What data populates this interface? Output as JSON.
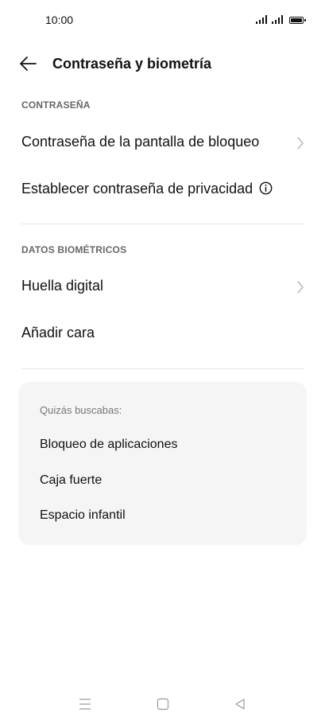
{
  "status_bar": {
    "time": "10:00"
  },
  "header": {
    "title": "Contraseña y biometría",
    "back_icon": "arrow-left-icon"
  },
  "sections": {
    "password": {
      "label": "CONTRASEÑA",
      "items": [
        {
          "label": "Contraseña de la pantalla de bloqueo",
          "trailing": "chevron-right-icon"
        },
        {
          "label": "Establecer contraseña de privacidad",
          "trailing": "info-icon"
        }
      ]
    },
    "biometrics": {
      "label": "DATOS BIOMÉTRICOS",
      "items": [
        {
          "label": "Huella digital",
          "trailing": "chevron-right-icon"
        },
        {
          "label": "Añadir cara"
        }
      ]
    }
  },
  "suggestions": {
    "title": "Quizás buscabas:",
    "items": [
      "Bloqueo de aplicaciones",
      "Caja fuerte",
      "Espacio infantil"
    ]
  },
  "nav_bar": {
    "icons": [
      "menu-icon",
      "home-icon",
      "back-triangle-icon"
    ]
  }
}
